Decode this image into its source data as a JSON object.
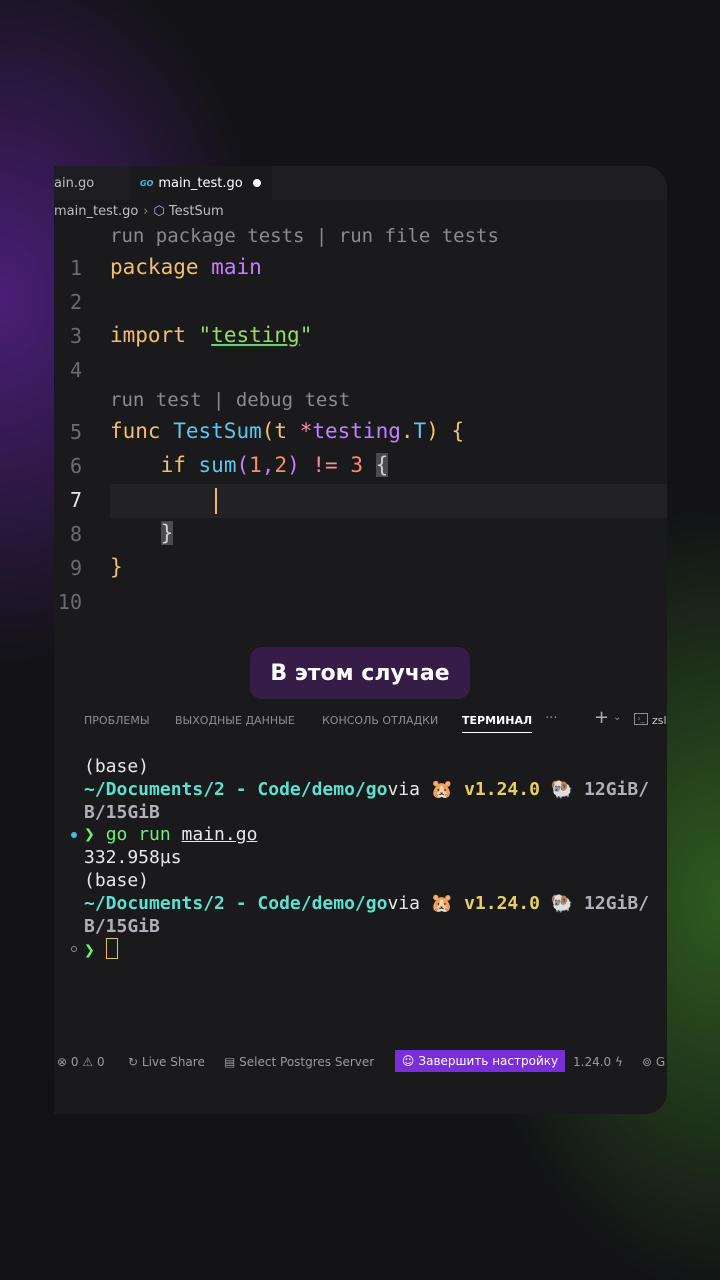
{
  "tabs": [
    {
      "label": "ain.go",
      "active": false
    },
    {
      "label": "main_test.go",
      "active": true,
      "modified": true,
      "icon": "go-file-icon"
    }
  ],
  "breadcrumb": {
    "file": "main_test.go",
    "symbol": "TestSum"
  },
  "editor": {
    "codelens_top": "run package tests | run file tests",
    "codelens_func": "run test | debug test",
    "line_numbers": [
      "1",
      "2",
      "3",
      "4",
      "5",
      "6",
      "7",
      "8",
      "9",
      "10"
    ],
    "current_line": "7",
    "code": {
      "l1_kw": "package",
      "l1_name": "main",
      "l3_kw": "import",
      "l3_q1": "\"",
      "l3_str": "testing",
      "l3_q2": "\"",
      "l5_kw": "func",
      "l5_fn": "TestSum",
      "l5_p1": "(",
      "l5_t": "t",
      "l5_star": " *",
      "l5_pkg": "testing",
      "l5_dot": ".",
      "l5_type": "T",
      "l5_p2": ")",
      "l5_brace": " {",
      "l6_kw": "if",
      "l6_fn": "sum",
      "l6_p1": "(",
      "l6_n1": "1",
      "l6_comma": ",",
      "l6_n2": "2",
      "l6_p2": ")",
      "l6_op": " != ",
      "l6_n3": "3",
      "l6_brace": "{",
      "l8_brace": "}",
      "l9_brace": "}"
    }
  },
  "caption": "В этом случае",
  "panel": {
    "tabs": [
      "ПРОБЛЕМЫ",
      "ВЫХОДНЫЕ ДАННЫЕ",
      "КОНСОЛЬ ОТЛАДКИ",
      "ТЕРМИНАЛ",
      "···"
    ],
    "active": "ТЕРМИНАЛ",
    "shell": "zsl"
  },
  "terminal": {
    "l1": "(base)",
    "l2_path": "~/Documents/2 - Code/demo/go",
    "l2_via": "via ",
    "l2_ver": "v1.24.0",
    "l2_mem": "12GiB/",
    "l3": "B/15GiB",
    "l4_arrow": "❯",
    "l4_cmd": "go run ",
    "l4_file": "main.go",
    "l5": "332.958µs",
    "l6": "(base)",
    "l7_path": "~/Documents/2 - Code/demo/go",
    "l7_via": "via ",
    "l7_ver": "v1.24.0",
    "l7_mem": "12GiB/",
    "l8": "B/15GiB",
    "l9_arrow": "❯"
  },
  "status": {
    "errors": "0",
    "warnings": "0",
    "live_share": "Live Share",
    "postgres": "Select Postgres Server",
    "finish_setup": "Завершить настройку",
    "go_version": "1.24.0",
    "last": "G"
  },
  "colors": {
    "accent": "#7a2ed8",
    "terminal_path": "#5ee0d0",
    "prompt": "#6ff070"
  }
}
